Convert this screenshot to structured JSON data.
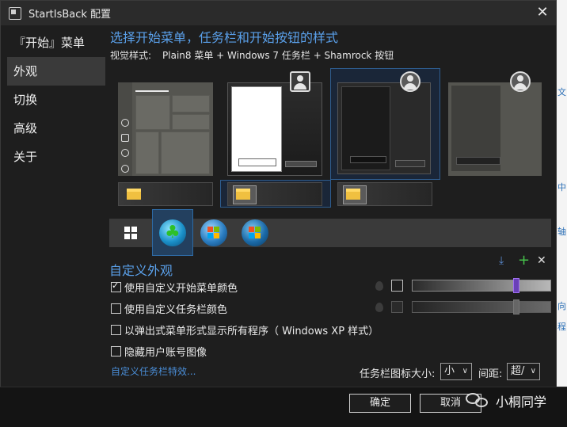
{
  "window": {
    "title": "StartIsBack 配置",
    "close_glyph": "✕"
  },
  "sidebar": {
    "items": [
      {
        "label": "『开始』菜单",
        "active": false
      },
      {
        "label": "外观",
        "active": true
      },
      {
        "label": "切换",
        "active": false
      },
      {
        "label": "高级",
        "active": false
      },
      {
        "label": "关于",
        "active": false
      }
    ]
  },
  "main": {
    "heading": "选择开始菜单，任务栏和开始按钮的样式",
    "visual_style_label": "视觉样式:",
    "visual_style_value": "Plain8 菜单 + Windows 7 任务栏 + Shamrock 按钮"
  },
  "customize": {
    "heading": "自定义外观",
    "options": [
      {
        "label": "使用自定义开始菜单颜色",
        "checked": true
      },
      {
        "label": "使用自定义任务栏颜色",
        "checked": false
      },
      {
        "label": "以弹出式菜单形式显示所有程序（ Windows XP 样式）",
        "checked": false
      },
      {
        "label": "隐藏用户账号图像",
        "checked": false
      }
    ],
    "link": "自定义任务栏特效...",
    "icon_size_label": "任务栏图标大小:",
    "icon_size_value": "小",
    "spacing_label": "间距:",
    "spacing_value": "超/"
  },
  "footer": {
    "ok_label": "确定",
    "cancel_label": "取消",
    "watermark": "小桐同学"
  },
  "colors": {
    "accent": "#5aa0ea",
    "window_bg": "#1e1e1e",
    "selection": "#2e5c8e"
  },
  "icons": [
    "app-icon",
    "close-icon",
    "user-avatar-icon",
    "folder-icon",
    "windows-logo-icon",
    "shamrock-orb-icon",
    "windows7-orb-icon",
    "windows8-orb-icon",
    "arrow-down-icon",
    "plus-icon",
    "x-icon",
    "chat-bubble-icon"
  ],
  "background_glyphs": [
    "文",
    "中",
    "轴",
    "向",
    "程"
  ]
}
